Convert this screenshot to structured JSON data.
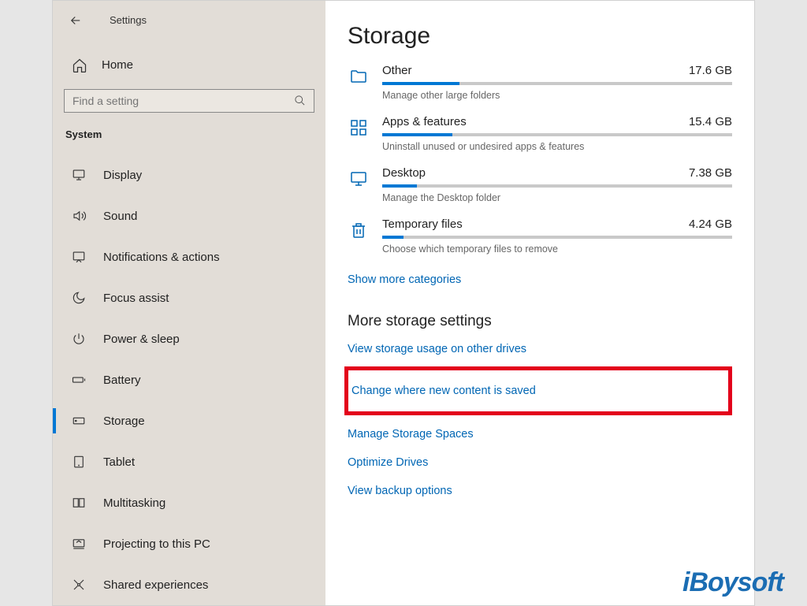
{
  "header": {
    "title": "Settings"
  },
  "home": {
    "label": "Home"
  },
  "search": {
    "placeholder": "Find a setting"
  },
  "section": {
    "label": "System"
  },
  "nav": [
    {
      "label": "Display",
      "icon": "monitor"
    },
    {
      "label": "Sound",
      "icon": "sound"
    },
    {
      "label": "Notifications & actions",
      "icon": "notification"
    },
    {
      "label": "Focus assist",
      "icon": "moon"
    },
    {
      "label": "Power & sleep",
      "icon": "power"
    },
    {
      "label": "Battery",
      "icon": "battery"
    },
    {
      "label": "Storage",
      "icon": "storage",
      "active": true
    },
    {
      "label": "Tablet",
      "icon": "tablet"
    },
    {
      "label": "Multitasking",
      "icon": "multitask"
    },
    {
      "label": "Projecting to this PC",
      "icon": "project"
    },
    {
      "label": "Shared experiences",
      "icon": "shared"
    }
  ],
  "main": {
    "heading": "Storage",
    "items": [
      {
        "name": "Other",
        "size": "17.6 GB",
        "fill": 22,
        "desc": "Manage other large folders",
        "icon": "folder"
      },
      {
        "name": "Apps & features",
        "size": "15.4 GB",
        "fill": 20,
        "desc": "Uninstall unused or undesired apps & features",
        "icon": "apps"
      },
      {
        "name": "Desktop",
        "size": "7.38 GB",
        "fill": 10,
        "desc": "Manage the Desktop folder",
        "icon": "desktop"
      },
      {
        "name": "Temporary files",
        "size": "4.24 GB",
        "fill": 6,
        "desc": "Choose which temporary files to remove",
        "icon": "trash"
      }
    ],
    "show_more": "Show more categories",
    "more_heading": "More storage settings",
    "links": [
      "View storage usage on other drives",
      "Change where new content is saved",
      "Manage Storage Spaces",
      "Optimize Drives",
      "View backup options"
    ],
    "highlight_index": 1
  },
  "watermark": "iBoysoft"
}
